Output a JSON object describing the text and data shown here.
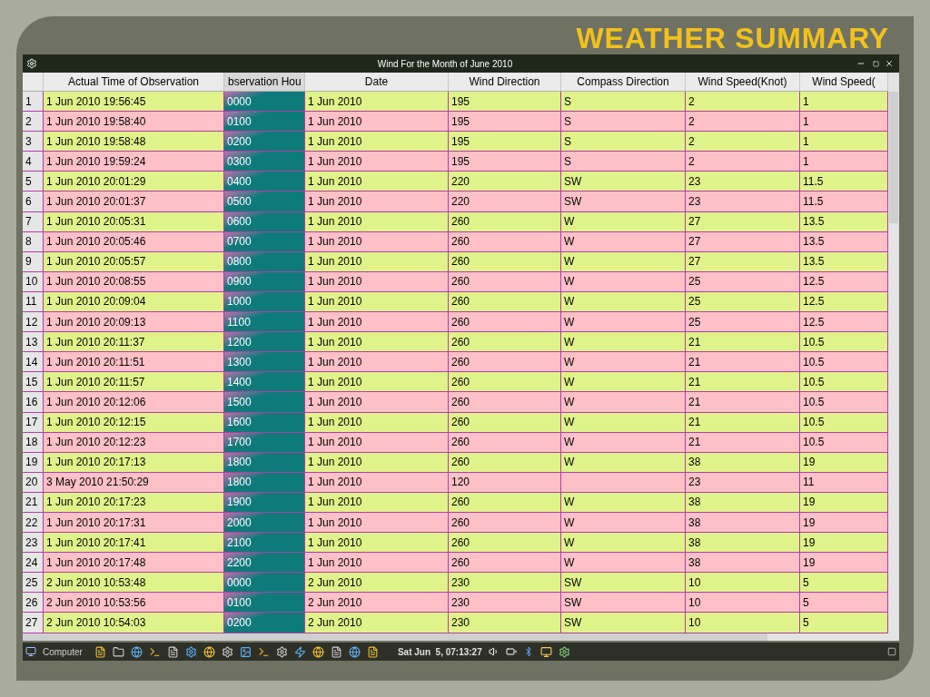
{
  "slide_title": "WEATHER SUMMARY",
  "window": {
    "title": "Wind For the Month of  June 2010"
  },
  "table": {
    "columns": [
      {
        "selected": false
      },
      {
        "label": "Actual Time of Observation",
        "selected": false
      },
      {
        "label": "bservation Hou",
        "selected": true
      },
      {
        "label": "Date",
        "selected": false
      },
      {
        "label": "Wind Direction",
        "selected": false
      },
      {
        "label": "Compass Direction",
        "selected": false
      },
      {
        "label": "Wind Speed(Knot)",
        "selected": false
      },
      {
        "label": "Wind Speed(",
        "selected": false
      }
    ],
    "rows": [
      [
        "1",
        "1 Jun 2010 19:56:45",
        "0000",
        "1 Jun 2010",
        "195",
        "S",
        "2",
        "1"
      ],
      [
        "2",
        "1 Jun 2010 19:58:40",
        "0100",
        "1 Jun 2010",
        "195",
        "S",
        "2",
        "1"
      ],
      [
        "3",
        "1 Jun 2010 19:58:48",
        "0200",
        "1 Jun 2010",
        "195",
        "S",
        "2",
        "1"
      ],
      [
        "4",
        "1 Jun 2010 19:59:24",
        "0300",
        "1 Jun 2010",
        "195",
        "S",
        "2",
        "1"
      ],
      [
        "5",
        "1 Jun 2010 20:01:29",
        "0400",
        "1 Jun 2010",
        "220",
        "SW",
        "23",
        "11.5"
      ],
      [
        "6",
        "1 Jun 2010 20:01:37",
        "0500",
        "1 Jun 2010",
        "220",
        "SW",
        "23",
        "11.5"
      ],
      [
        "7",
        "1 Jun 2010 20:05:31",
        "0600",
        "1 Jun 2010",
        "260",
        "W",
        "27",
        "13.5"
      ],
      [
        "8",
        "1 Jun 2010 20:05:46",
        "0700",
        "1 Jun 2010",
        "260",
        "W",
        "27",
        "13.5"
      ],
      [
        "9",
        "1 Jun 2010 20:05:57",
        "0800",
        "1 Jun 2010",
        "260",
        "W",
        "27",
        "13.5"
      ],
      [
        "10",
        "1 Jun 2010 20:08:55",
        "0900",
        "1 Jun 2010",
        "260",
        "W",
        "25",
        "12.5"
      ],
      [
        "11",
        "1 Jun 2010 20:09:04",
        "1000",
        "1 Jun 2010",
        "260",
        "W",
        "25",
        "12.5"
      ],
      [
        "12",
        "1 Jun 2010 20:09:13",
        "1100",
        "1 Jun 2010",
        "260",
        "W",
        "25",
        "12.5"
      ],
      [
        "13",
        "1 Jun 2010 20:11:37",
        "1200",
        "1 Jun 2010",
        "260",
        "W",
        "21",
        "10.5"
      ],
      [
        "14",
        "1 Jun 2010 20:11:51",
        "1300",
        "1 Jun 2010",
        "260",
        "W",
        "21",
        "10.5"
      ],
      [
        "15",
        "1 Jun 2010 20:11:57",
        "1400",
        "1 Jun 2010",
        "260",
        "W",
        "21",
        "10.5"
      ],
      [
        "16",
        "1 Jun 2010 20:12:06",
        "1500",
        "1 Jun 2010",
        "260",
        "W",
        "21",
        "10.5"
      ],
      [
        "17",
        "1 Jun 2010 20:12:15",
        "1600",
        "1 Jun 2010",
        "260",
        "W",
        "21",
        "10.5"
      ],
      [
        "18",
        "1 Jun 2010 20:12:23",
        "1700",
        "1 Jun 2010",
        "260",
        "W",
        "21",
        "10.5"
      ],
      [
        "19",
        "1 Jun 2010 20:17:13",
        "1800",
        "1 Jun 2010",
        "260",
        "W",
        "38",
        "19"
      ],
      [
        "20",
        "3 May 2010 21:50:29",
        "1800",
        "1 Jun 2010",
        "120",
        null,
        "23",
        "11"
      ],
      [
        "21",
        "1 Jun 2010 20:17:23",
        "1900",
        "1 Jun 2010",
        "260",
        "W",
        "38",
        "19"
      ],
      [
        "22",
        "1 Jun 2010 20:17:31",
        "2000",
        "1 Jun 2010",
        "260",
        "W",
        "38",
        "19"
      ],
      [
        "23",
        "1 Jun 2010 20:17:41",
        "2100",
        "1 Jun 2010",
        "260",
        "W",
        "38",
        "19"
      ],
      [
        "24",
        "1 Jun 2010 20:17:48",
        "2200",
        "1 Jun 2010",
        "260",
        "W",
        "38",
        "19"
      ],
      [
        "25",
        "2 Jun 2010 10:53:48",
        "0000",
        "2 Jun 2010",
        "230",
        "SW",
        "10",
        "5"
      ],
      [
        "26",
        "2 Jun 2010 10:53:56",
        "0100",
        "2 Jun 2010",
        "230",
        "SW",
        "10",
        "5"
      ],
      [
        "27",
        "2 Jun 2010 10:54:03",
        "0200",
        "2 Jun 2010",
        "230",
        "SW",
        "10",
        "5"
      ]
    ]
  },
  "taskbar": {
    "start_label": "Computer",
    "clock": "Sat Jun  5, 07:13:27"
  }
}
